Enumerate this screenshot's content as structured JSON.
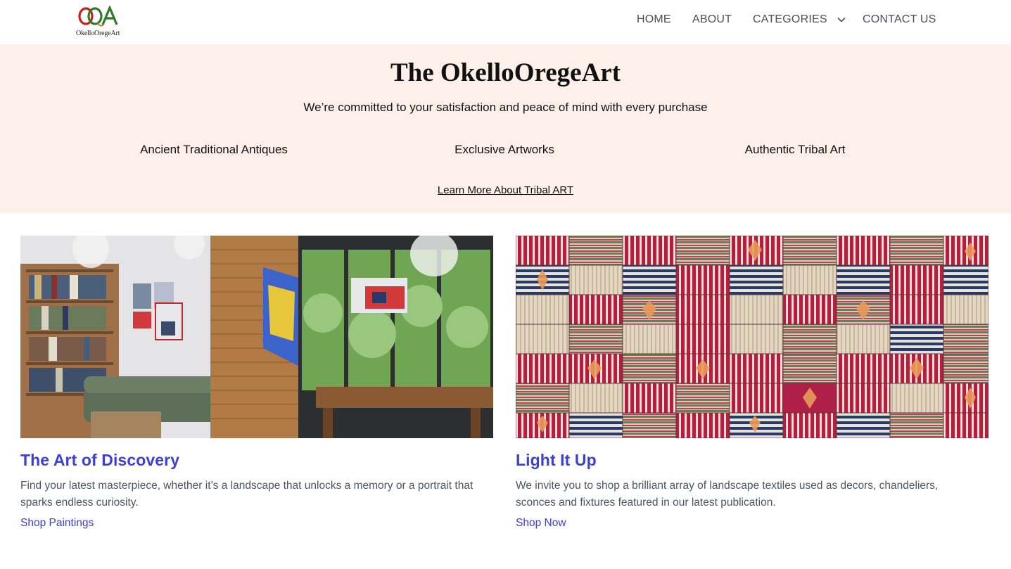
{
  "brand": {
    "name": "OkelloOregeArt",
    "logo_letters": "OOA"
  },
  "nav": {
    "home": "HOME",
    "about": "ABOUT",
    "categories": "CATEGORIES",
    "contact": "CONTACT US",
    "categories_icon": "chevron-down-icon"
  },
  "hero": {
    "title": "The OkelloOregeArt",
    "subtitle": "We’re committed to your satisfaction and peace of mind with every purchase",
    "features": [
      "Ancient Traditional Antiques",
      "Exclusive Artworks",
      "Authentic Tribal Art"
    ],
    "link": "Learn More About Tribal ART",
    "background": "#fdf0ea"
  },
  "cards": [
    {
      "title": "The Art of Discovery",
      "description": "Find your latest masterpiece, whether it’s a landscape that unlocks a memory or a portrait that sparks endless curiosity.",
      "link": "Shop Paintings"
    },
    {
      "title": "Light It Up",
      "description": "We invite you to shop a brilliant array of landscape textiles used as decors, chandeliers, sconces and fixtures featured in our latest publication.",
      "link": "Shop Now"
    }
  ],
  "colors": {
    "accent": "#3b3fd6",
    "nav_text": "#4a4f57",
    "body_text": "#4b5563"
  }
}
